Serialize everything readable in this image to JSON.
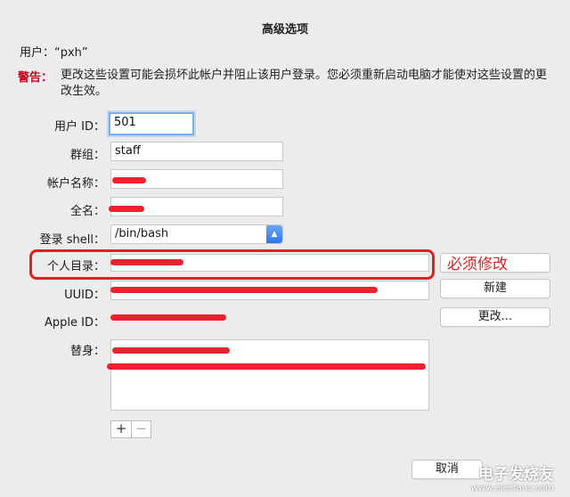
{
  "dialog": {
    "title": "高级选项",
    "user_line": "用户：“pxh”",
    "warning_label": "警告：",
    "warning_text": "更改这些设置可能会损坏此帐户并阻止该用户登录。您必须重新启动电脑才能使对这些设置的更改生效。"
  },
  "form": {
    "user_id": {
      "label": "用户 ID：",
      "value": "501"
    },
    "group": {
      "label": "群组：",
      "value": "staff"
    },
    "account_name": {
      "label": "帐户名称：",
      "value": ""
    },
    "full_name": {
      "label": "全名：",
      "value": ""
    },
    "login_shell": {
      "label": "登录 shell：",
      "value": "/bin/bash"
    },
    "home_dir": {
      "label": "个人目录：",
      "value": ""
    },
    "uuid": {
      "label": "UUID：",
      "value": ""
    },
    "apple_id": {
      "label": "Apple ID：",
      "value": ""
    },
    "aliases": {
      "label": "替身："
    }
  },
  "buttons": {
    "new_uuid": "新建",
    "change_apple_id": "更改...",
    "cancel": "取消"
  },
  "annotation": {
    "text": "必须修改",
    "color": "#e02020"
  },
  "watermark": {
    "brand": "电子发烧友",
    "url": "www.elecfans.com"
  },
  "colors": {
    "background": "#ececec",
    "warning": "#d0021b",
    "focus_ring": "#7aaef2",
    "redaction": "#e8101c"
  }
}
